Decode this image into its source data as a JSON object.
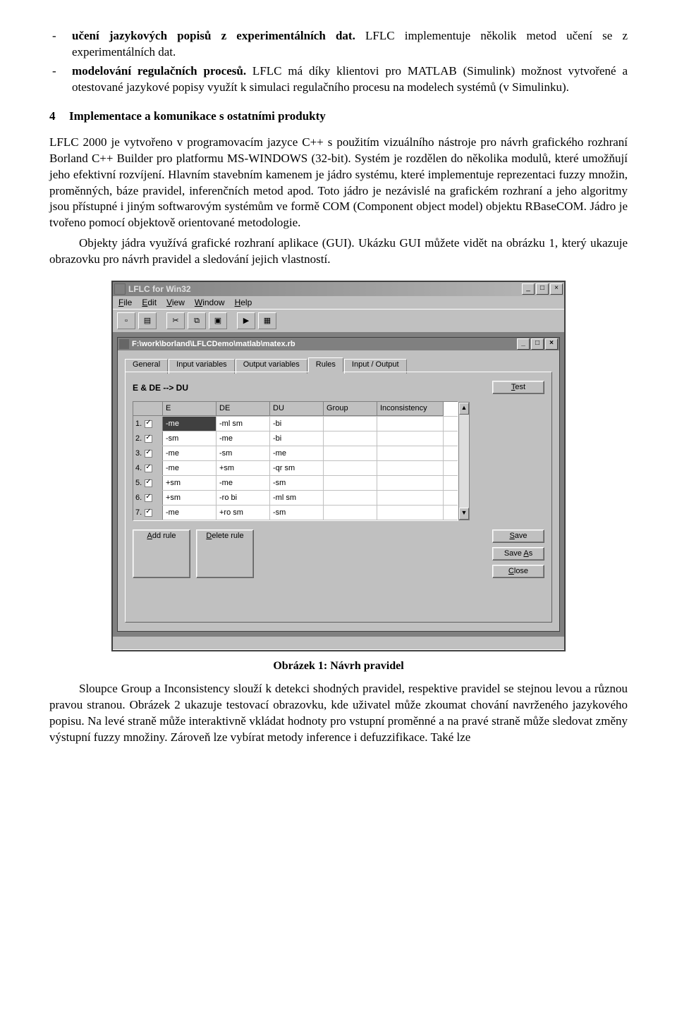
{
  "bullets": [
    {
      "lead": "učení jazykových popisů z experimentálních dat.",
      "rest": " LFLC implementuje několik metod učení se z experimentálních dat."
    },
    {
      "lead": "modelování regulačních procesů.",
      "rest": " LFLC má díky klientovi pro MATLAB (Simulink) možnost vytvořené a otestované jazykové popisy využít k simulaci regulačního procesu na modelech systémů (v Simulinku)."
    }
  ],
  "section_number": "4",
  "section_title": "Implementace a komunikace s ostatními produkty",
  "para1": "LFLC 2000 je vytvořeno v programovacím jazyce C++ s použitím vizuálního nástroje pro návrh grafického rozhraní Borland C++ Builder pro platformu MS-WINDOWS (32-bit). Systém je rozdělen do několika modulů, které umožňují jeho efektivní rozvíjení. Hlavním stavebním kamenem je jádro systému, které implementuje reprezentaci fuzzy množin, proměnných, báze pravidel, inferenčních metod apod. Toto jádro je nezávislé na grafickém rozhraní a jeho algoritmy jsou přístupné i jiným softwarovým systémům ve formě COM (Component object model) objektu RBaseCOM. Jádro je tvořeno pomocí objektově orientované metodologie.",
  "para2": "Objekty jádra využívá grafické rozhraní aplikace (GUI). Ukázku GUI můžete vidět na obrázku 1, který ukazuje obrazovku pro návrh pravidel a sledování jejich vlastností.",
  "app": {
    "title": "LFLC for Win32",
    "menu": [
      "File",
      "Edit",
      "View",
      "Window",
      "Help"
    ],
    "doc_title": "F:\\work\\borland\\LFLCDemo\\matlab\\matex.rb",
    "tabs": [
      "General",
      "Input variables",
      "Output variables",
      "Rules",
      "Input / Output"
    ],
    "active_tab": 3,
    "rule_label": "E & DE --> DU",
    "columns": [
      "",
      "E",
      "DE",
      "DU",
      "Group",
      "Inconsistency"
    ],
    "rows": [
      {
        "n": "1.",
        "chk": true,
        "E": "-me",
        "DE": "-ml sm",
        "DU": "-bi"
      },
      {
        "n": "2.",
        "chk": true,
        "E": "-sm",
        "DE": "-me",
        "DU": "-bi"
      },
      {
        "n": "3.",
        "chk": true,
        "E": "-me",
        "DE": "-sm",
        "DU": "-me"
      },
      {
        "n": "4.",
        "chk": true,
        "E": "-me",
        "DE": "+sm",
        "DU": "-qr sm"
      },
      {
        "n": "5.",
        "chk": true,
        "E": "+sm",
        "DE": "-me",
        "DU": "-sm"
      },
      {
        "n": "6.",
        "chk": true,
        "E": "+sm",
        "DE": "-ro bi",
        "DU": "-ml sm"
      },
      {
        "n": "7.",
        "chk": true,
        "E": "-me",
        "DE": "+ro sm",
        "DU": "-sm"
      }
    ],
    "btn_test": "Test",
    "btn_add": "Add rule",
    "btn_del": "Delete rule",
    "btn_save": "Save",
    "btn_saveas": "Save As",
    "btn_close": "Close"
  },
  "caption": "Obrázek 1: Návrh pravidel",
  "para3": "Sloupce Group a Inconsistency slouží k detekci shodných pravidel, respektive pravidel se stejnou levou a různou pravou stranou. Obrázek 2 ukazuje testovací obrazovku, kde uživatel může zkoumat chování navrženého jazykového popisu. Na levé straně může interaktivně vkládat hodnoty pro vstupní proměnné a na pravé straně může sledovat změny výstupní fuzzy množiny. Zároveň lze vybírat metody inference i defuzzifikace. Také lze"
}
